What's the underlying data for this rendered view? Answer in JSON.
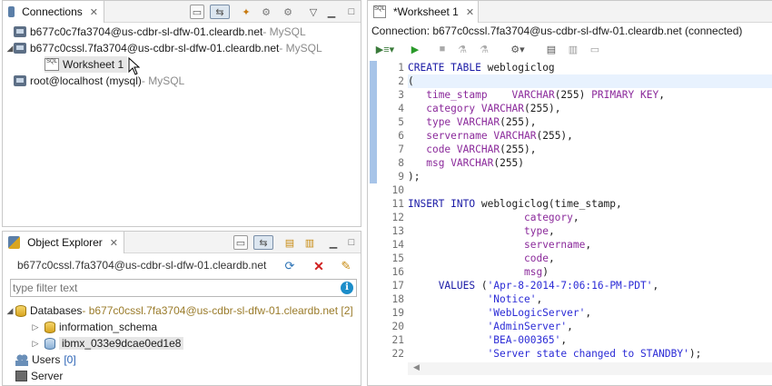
{
  "connections_panel": {
    "tab_label": "Connections",
    "items": [
      {
        "name": "b677c0c7fa3704@us-cdbr-sl-dfw-01.cleardb.net",
        "suffix": " - MySQL"
      },
      {
        "name": "b677c0cssl.7fa3704@us-cdbr-sl-dfw-01.cleardb.net",
        "suffix": " - MySQL"
      },
      {
        "name": "Worksheet 1",
        "suffix": ""
      },
      {
        "name": "root@localhost (mysql)",
        "suffix": " - MySQL"
      }
    ]
  },
  "object_explorer": {
    "tab_label": "Object Explorer",
    "connection": "b677c0cssl.7fa3704@us-cdbr-sl-dfw-01.cleardb.net",
    "filter_placeholder": "type filter text",
    "databases_label": "Databases",
    "databases_suffix": " - b677c0cssl.7fa3704@us-cdbr-sl-dfw-01.cleardb.net [2]",
    "databases": [
      "information_schema",
      "ibmx_033e9dcae0ed1e8"
    ],
    "users_label": "Users",
    "users_count": "[0]",
    "server_label": "Server"
  },
  "worksheet": {
    "tab_label": "*Worksheet 1",
    "connection_line": "Connection: b677c0cssl.7fa3704@us-cdbr-sl-dfw-01.cleardb.net (connected)"
  },
  "colors": {
    "keyword": "#1a1aa6",
    "type": "#8b2a9b",
    "string": "#2b2bd6",
    "current_line": "#e8f2fe"
  }
}
